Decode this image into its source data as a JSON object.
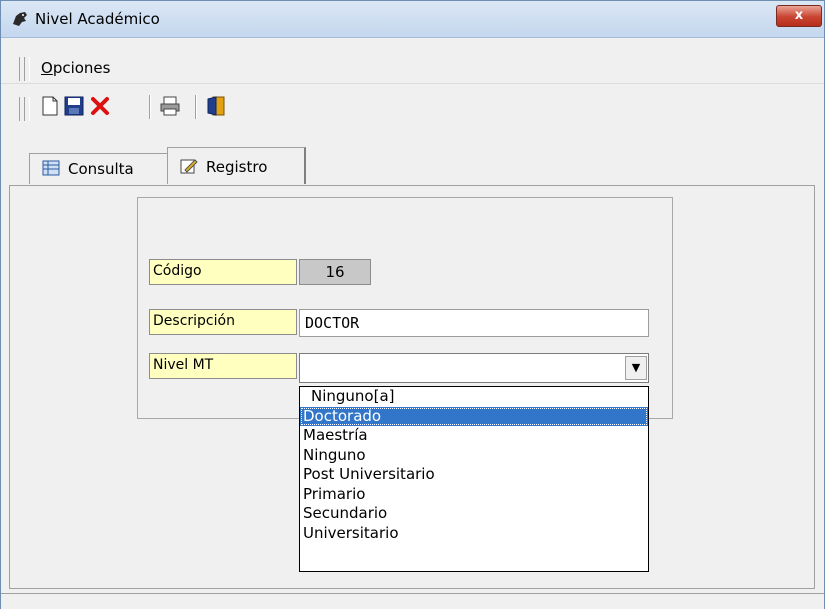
{
  "window": {
    "title": "Nivel Académico",
    "close_label": "x"
  },
  "menu": {
    "opciones": "Opciones"
  },
  "toolbar": {
    "icons": [
      "new-document-icon",
      "save-icon",
      "delete-icon",
      "print-icon",
      "exit-icon"
    ]
  },
  "tabs": [
    {
      "label": "Consulta",
      "icon": "table-icon",
      "active": false
    },
    {
      "label": "Registro",
      "icon": "edit-icon",
      "active": true
    }
  ],
  "form": {
    "codigo": {
      "label": "Código",
      "value": "16"
    },
    "descripcion": {
      "label": "Descripción",
      "value": "DOCTOR"
    },
    "nivel_mt": {
      "label": "Nivel MT",
      "value": ""
    }
  },
  "dropdown": {
    "options": [
      "Ninguno[a]",
      "Doctorado",
      "Maestría",
      "Ninguno",
      "Post Universitario",
      "Primario",
      "Secundario",
      "Universitario"
    ],
    "selected": "Doctorado"
  },
  "colors": {
    "label_bg": "#ffffc0",
    "selection": "#3176c9",
    "close_button": "#c94431"
  }
}
